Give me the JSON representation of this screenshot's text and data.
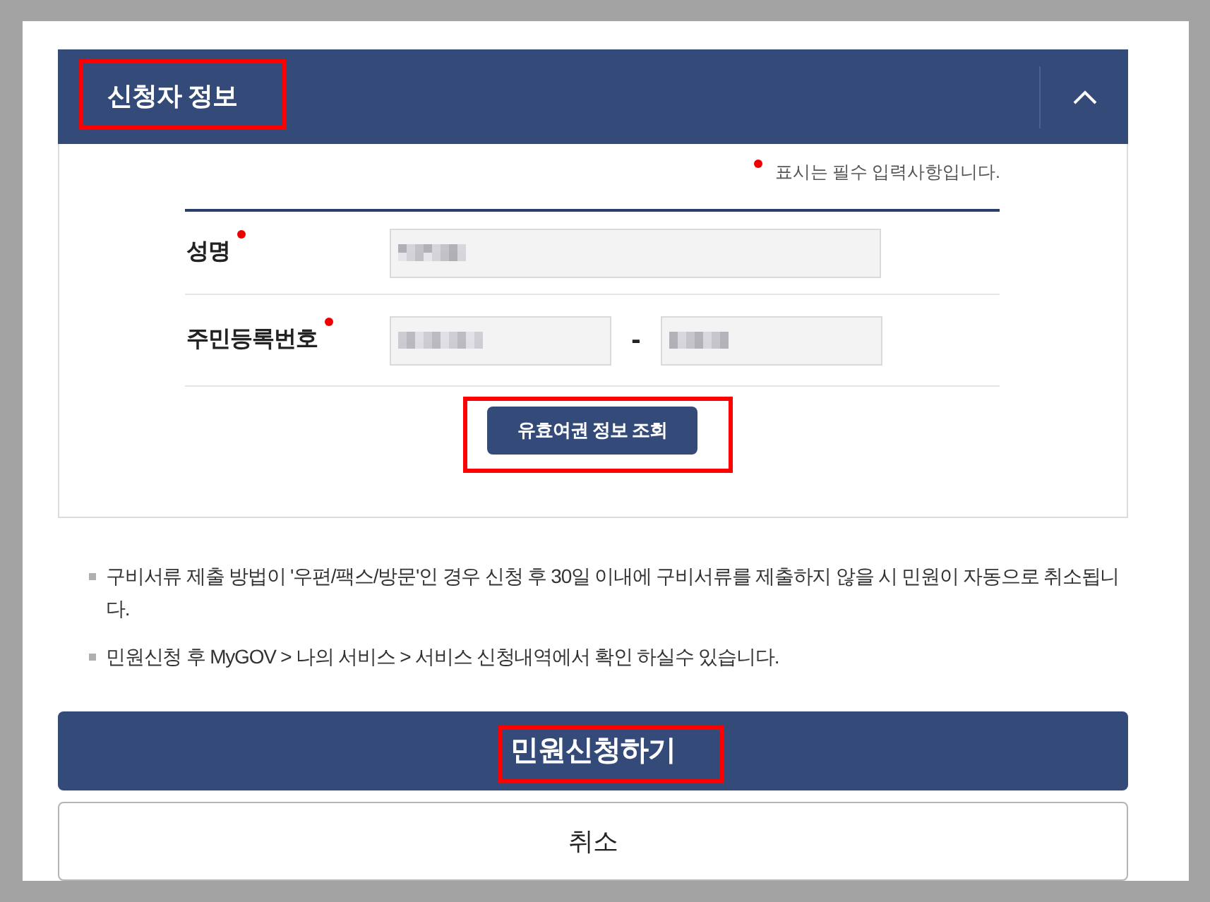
{
  "section": {
    "title": "신청자 정보",
    "title_highlighted": true,
    "expanded": true
  },
  "required_note": {
    "text": "표시는 필수 입력사항입니다."
  },
  "fields": [
    {
      "label": "성명",
      "required": true,
      "kind": "single",
      "inputs": [
        {
          "redacted": true
        }
      ]
    },
    {
      "label": "주민등록번호",
      "required": true,
      "kind": "split",
      "separator": "-",
      "inputs": [
        {
          "redacted": true
        },
        {
          "redacted": true
        }
      ]
    }
  ],
  "lookup_button": {
    "label": "유효여권 정보 조회",
    "highlighted": true
  },
  "notes": [
    "구비서류 제출 방법이 '우편/팩스/방문'인 경우 신청 후 30일 이내에 구비서류를 제출하지 않을 시 민원이 자동으로 취소됩니다.",
    "민원신청 후 MyGOV > 나의 서비스 > 서비스 신청내역에서 확인 하실수 있습니다."
  ],
  "buttons": [
    {
      "label": "민원신청하기",
      "kind": "primary",
      "highlighted": true
    },
    {
      "label": "취소",
      "kind": "secondary",
      "highlighted": false
    }
  ]
}
